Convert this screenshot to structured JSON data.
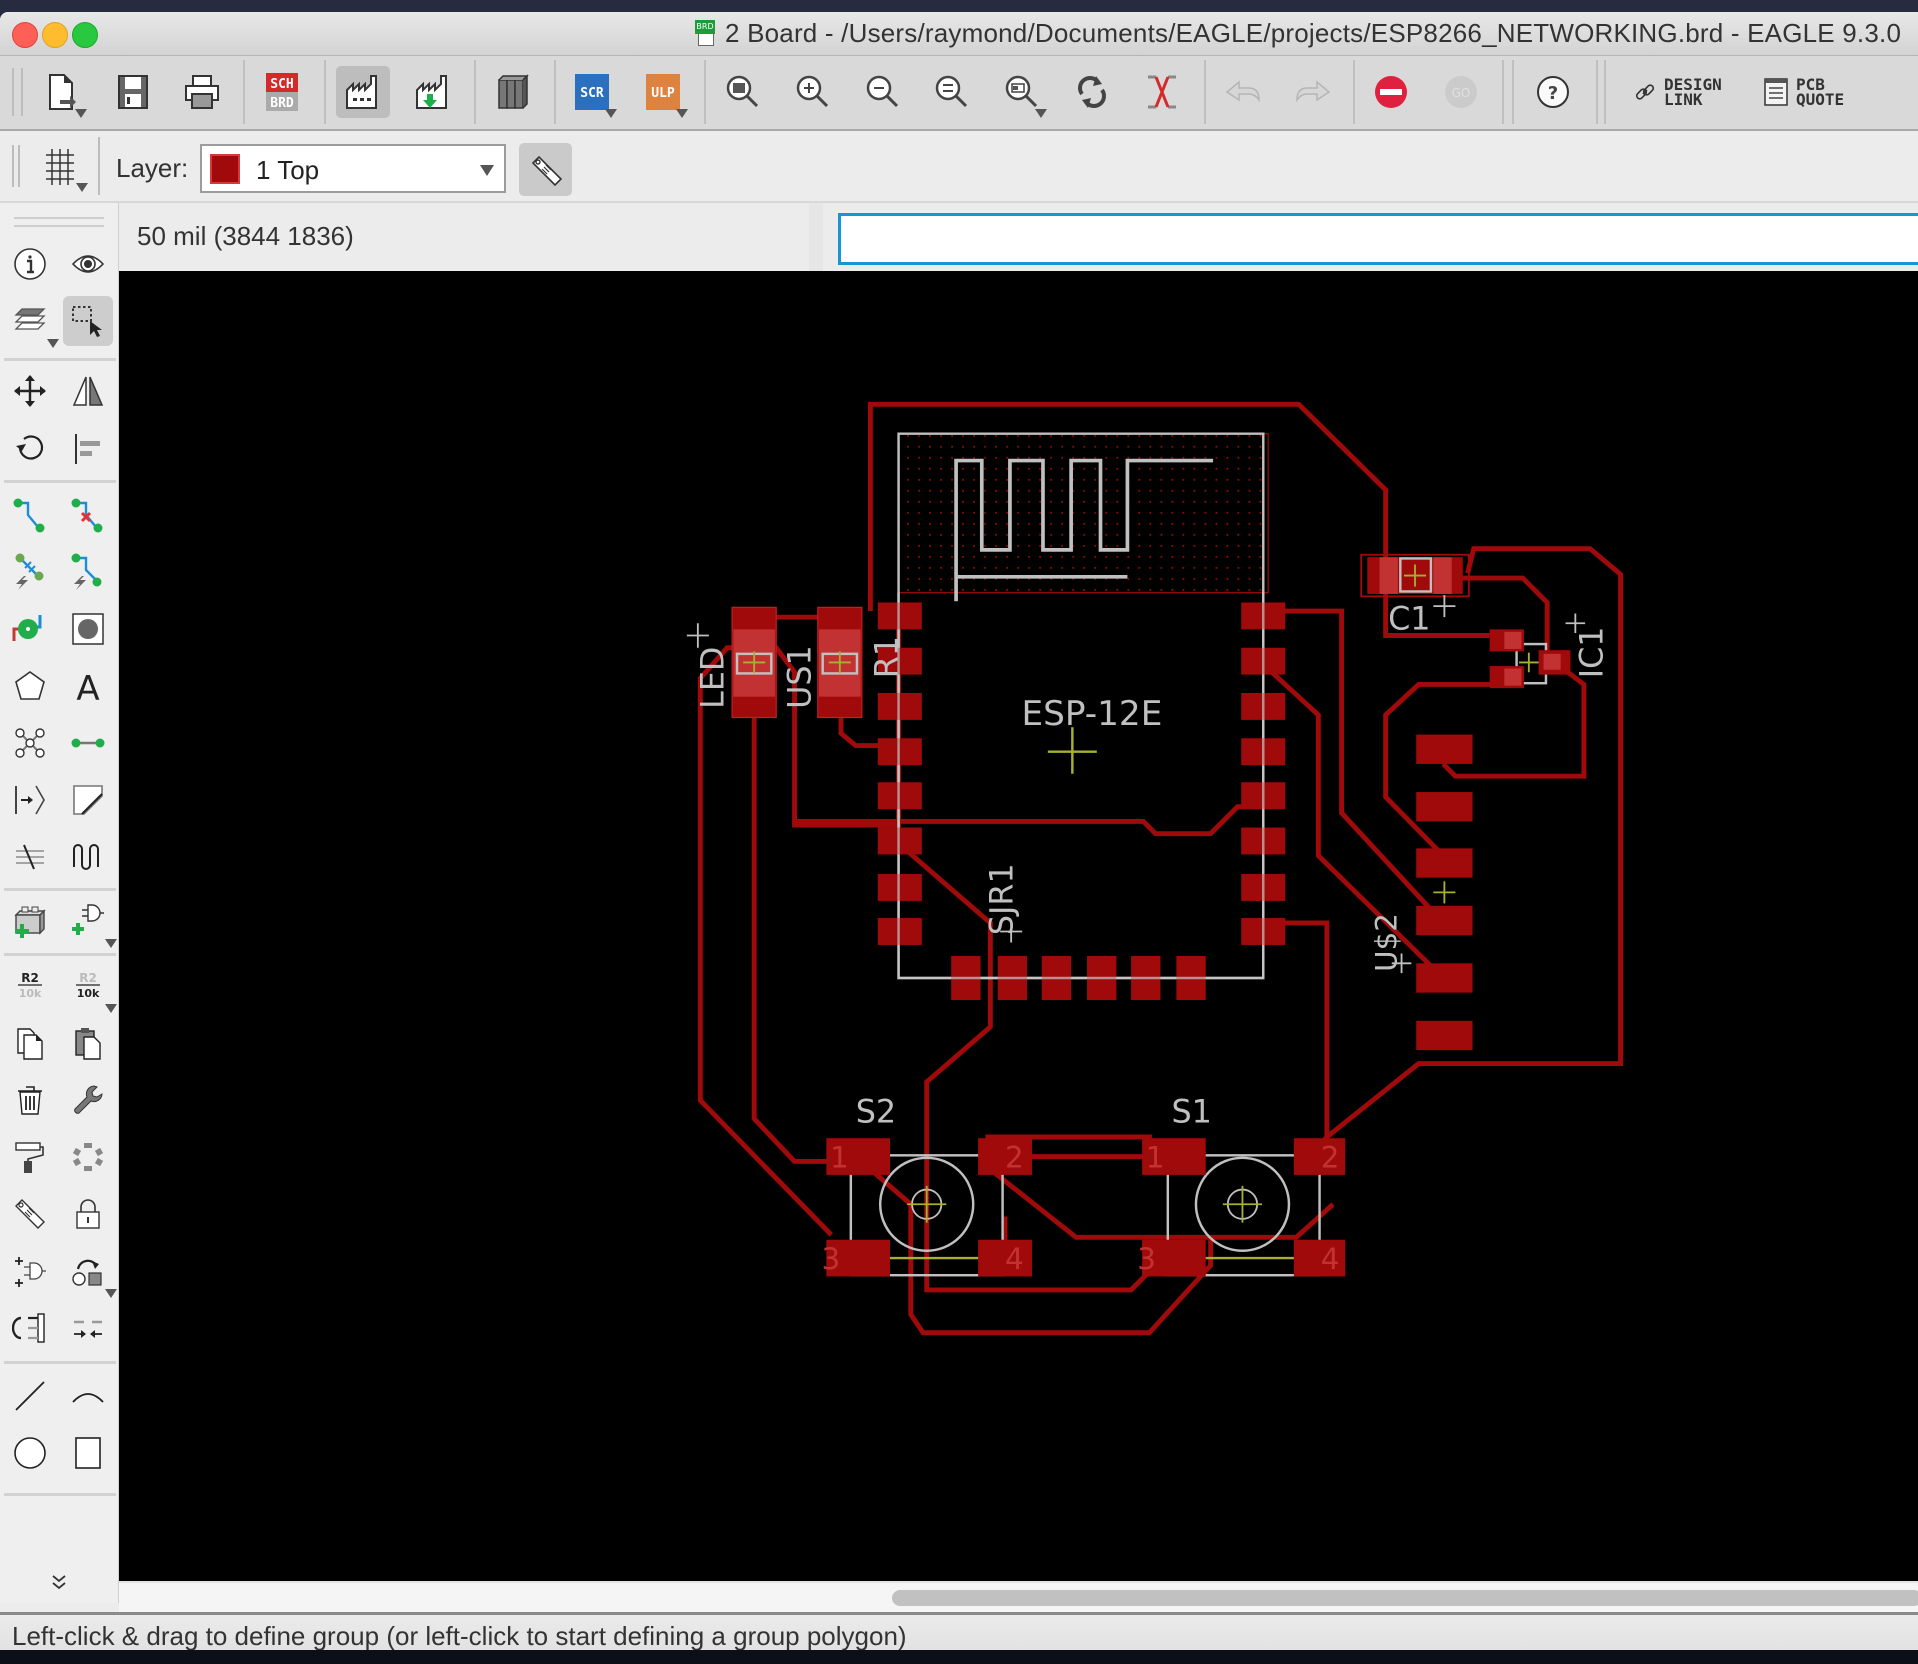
{
  "window": {
    "title": "2 Board - /Users/raymond/Documents/EAGLE/projects/ESP8266_NETWORKING.brd - EAGLE 9.3.0",
    "doc_badge": "BRD",
    "controls": [
      "close",
      "minimize",
      "maximize"
    ]
  },
  "toolbar": {
    "buttons": [
      {
        "id": "open",
        "icon": "open-file-icon",
        "has_menu": true
      },
      {
        "id": "save",
        "icon": "save-icon"
      },
      {
        "id": "print",
        "icon": "print-icon"
      },
      {
        "id": "sch_brd",
        "icon": "schematic-board-switch-icon",
        "text_top": "SCH",
        "text_bottom": "BRD"
      },
      {
        "id": "cam",
        "icon": "cam-processor-icon",
        "active": true
      },
      {
        "id": "manufacturing",
        "icon": "manufacturing-download-icon"
      },
      {
        "id": "library",
        "icon": "library-icon"
      },
      {
        "id": "script",
        "icon": "script-icon",
        "text": "SCR",
        "has_menu": true
      },
      {
        "id": "ulp",
        "icon": "ulp-icon",
        "text": "ULP",
        "has_menu": true
      },
      {
        "id": "zoom_fit",
        "icon": "zoom-fit-icon"
      },
      {
        "id": "zoom_in",
        "icon": "zoom-in-icon"
      },
      {
        "id": "zoom_out",
        "icon": "zoom-out-icon"
      },
      {
        "id": "zoom_redraw",
        "icon": "zoom-redraw-icon"
      },
      {
        "id": "zoom_select",
        "icon": "zoom-select-icon",
        "has_menu": true
      },
      {
        "id": "redraw",
        "icon": "refresh-icon"
      },
      {
        "id": "ratsnest",
        "icon": "ratsnest-icon"
      },
      {
        "id": "undo",
        "icon": "undo-icon",
        "disabled": true
      },
      {
        "id": "redo",
        "icon": "redo-icon",
        "disabled": true
      },
      {
        "id": "stop",
        "icon": "stop-icon"
      },
      {
        "id": "go",
        "icon": "go-icon",
        "text": "GO",
        "disabled": true
      },
      {
        "id": "help",
        "icon": "help-icon",
        "text": "?"
      }
    ],
    "design_link": {
      "line1": "DESIGN",
      "line2": "LINK"
    },
    "pcb_quote": {
      "line1": "PCB",
      "line2": "QUOTE"
    }
  },
  "layerbar": {
    "label": "Layer:",
    "selected_layer": "1 Top",
    "layer_color": "#a00a0a"
  },
  "coords": {
    "readout": "50 mil (3844 1836)",
    "command_value": ""
  },
  "left_tools": [
    [
      "info",
      "show"
    ],
    [
      "layer-settings",
      "group-select"
    ],
    [
      "move",
      "mirror"
    ],
    [
      "rotate",
      "align"
    ],
    [
      "route",
      "ripup"
    ],
    [
      "autorouter",
      "route-airwire"
    ],
    [
      "via",
      "hole"
    ],
    [
      "polygon",
      "text"
    ],
    [
      "signal",
      "wire-connect"
    ],
    [
      "attribute-arrow",
      "dimension"
    ],
    [
      "meander-length",
      "meander"
    ],
    [
      "add-part",
      "add-gate"
    ],
    [
      "name",
      "value"
    ],
    [
      "copy",
      "paste"
    ],
    [
      "delete",
      "change"
    ],
    [
      "paint-roller",
      "optimize"
    ],
    [
      "tag",
      "lock"
    ],
    [
      "replace",
      "smash-swap"
    ],
    [
      "swap-pins",
      "split"
    ],
    [
      "line",
      "arc"
    ],
    [
      "circle",
      "rectangle"
    ]
  ],
  "board": {
    "components": [
      {
        "ref": "ESP-12E",
        "type": "module"
      },
      {
        "ref": "LED",
        "type": "smd-0805"
      },
      {
        "ref": "US1",
        "type": "smd-0805"
      },
      {
        "ref": "R1",
        "type": "smd-0805"
      },
      {
        "ref": "C1",
        "type": "smd-0805"
      },
      {
        "ref": "IC1",
        "type": "sot-23"
      },
      {
        "ref": "U$2",
        "type": "header-6"
      },
      {
        "ref": "SJR1",
        "type": "solder-jumper"
      },
      {
        "ref": "S2",
        "type": "tactile-switch",
        "pins": [
          "1",
          "2",
          "3",
          "4"
        ]
      },
      {
        "ref": "S1",
        "type": "tactile-switch",
        "pins": [
          "1",
          "2",
          "3",
          "4"
        ]
      }
    ],
    "colors": {
      "copper_top": "#a00a0a",
      "pad": "#a00a0a",
      "silkscreen": "#c0c0c0",
      "origin": "#a8b030",
      "background": "#000000"
    }
  },
  "status": {
    "message": "Left-click & drag to define group (or left-click to start defining a group polygon)"
  }
}
